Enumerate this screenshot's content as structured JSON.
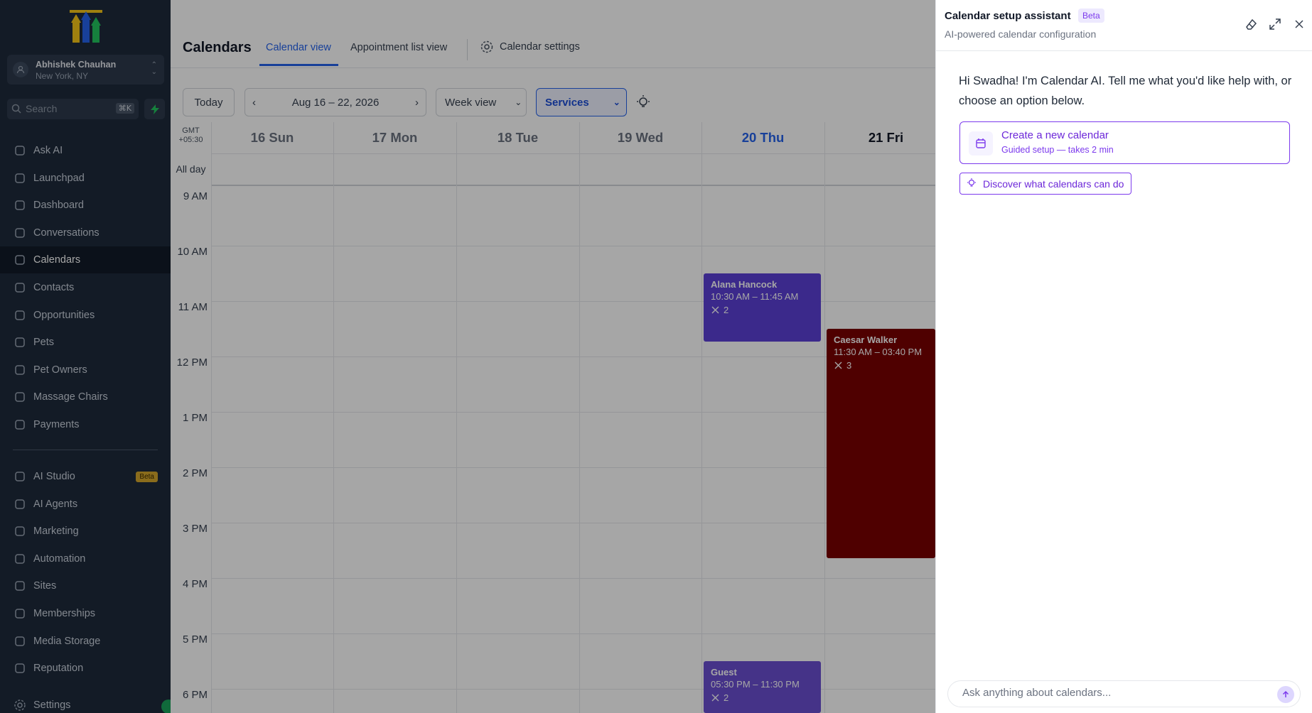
{
  "app": {
    "account_name": "Abhishek Chauhan",
    "account_location": "New York, NY",
    "search_placeholder": "Search",
    "search_shortcut": "⌘K"
  },
  "sidebar": {
    "items": [
      {
        "label": "Ask AI",
        "icon": "sparkle-icon"
      },
      {
        "label": "Launchpad",
        "icon": "rocket-icon"
      },
      {
        "label": "Dashboard",
        "icon": "dashboard-icon"
      },
      {
        "label": "Conversations",
        "icon": "chat-icon"
      },
      {
        "label": "Calendars",
        "icon": "calendar-icon"
      },
      {
        "label": "Contacts",
        "icon": "contacts-icon"
      },
      {
        "label": "Opportunities",
        "icon": "opportunities-icon"
      },
      {
        "label": "Pets",
        "icon": "location-pin-icon"
      },
      {
        "label": "Pet Owners",
        "icon": "box-icon"
      },
      {
        "label": "Massage Chairs",
        "icon": "pin-icon"
      },
      {
        "label": "Payments",
        "icon": "receipt-icon"
      }
    ],
    "items2": [
      {
        "label": "AI Studio",
        "icon": "ai-studio-icon",
        "badge": "Beta"
      },
      {
        "label": "AI Agents",
        "icon": "ai-agents-icon"
      },
      {
        "label": "Marketing",
        "icon": "send-icon"
      },
      {
        "label": "Automation",
        "icon": "automation-icon"
      },
      {
        "label": "Sites",
        "icon": "sites-icon"
      },
      {
        "label": "Memberships",
        "icon": "membership-icon"
      },
      {
        "label": "Media Storage",
        "icon": "image-icon"
      },
      {
        "label": "Reputation",
        "icon": "star-icon"
      }
    ],
    "settings_label": "Settings"
  },
  "header": {
    "title": "Calendars",
    "tabs": [
      "Calendar view",
      "Appointment list view"
    ],
    "settings_label": "Calendar settings"
  },
  "toolbar": {
    "today": "Today",
    "date_range": "Aug 16 – 22, 2026",
    "view": "Week view",
    "filter": "Services"
  },
  "calendar": {
    "timezone_line1": "GMT",
    "timezone_line2": "+05:30",
    "allday_label": "All day",
    "days": [
      "16 Sun",
      "17 Mon",
      "18 Tue",
      "19 Wed",
      "20 Thu",
      "21 Fri"
    ],
    "hours": [
      "9 AM",
      "10 AM",
      "11 AM",
      "12 PM",
      "1 PM",
      "2 PM",
      "3 PM",
      "4 PM",
      "5 PM",
      "6 PM"
    ],
    "events": [
      {
        "title": "Alana Hancock",
        "time": "10:30 AM – 11:45 AM",
        "count": "2",
        "color": "#5b3fd6"
      },
      {
        "title": "Caesar Walker",
        "time": "11:30 AM – 03:40 PM",
        "count": "3",
        "color": "#7a0000"
      },
      {
        "title": "Guest",
        "time": "05:30 PM – 11:30 PM",
        "count": "2",
        "color": "#6b4fd1"
      }
    ]
  },
  "panel": {
    "title": "Calendar setup assistant",
    "badge": "Beta",
    "subtitle": "AI-powered calendar configuration",
    "greeting": "Hi Swadha! I'm Calendar AI. Tell me what you'd like help with, or choose an option below.",
    "option1_title": "Create a new calendar",
    "option1_sub": "Guided setup — takes 2 min",
    "option2": "Discover what calendars can do",
    "input_placeholder": "Ask anything about calendars..."
  },
  "colors": {
    "sidebar_bg": "#1e2a3b",
    "accent_blue": "#2563eb",
    "accent_purple": "#7c3aed"
  }
}
